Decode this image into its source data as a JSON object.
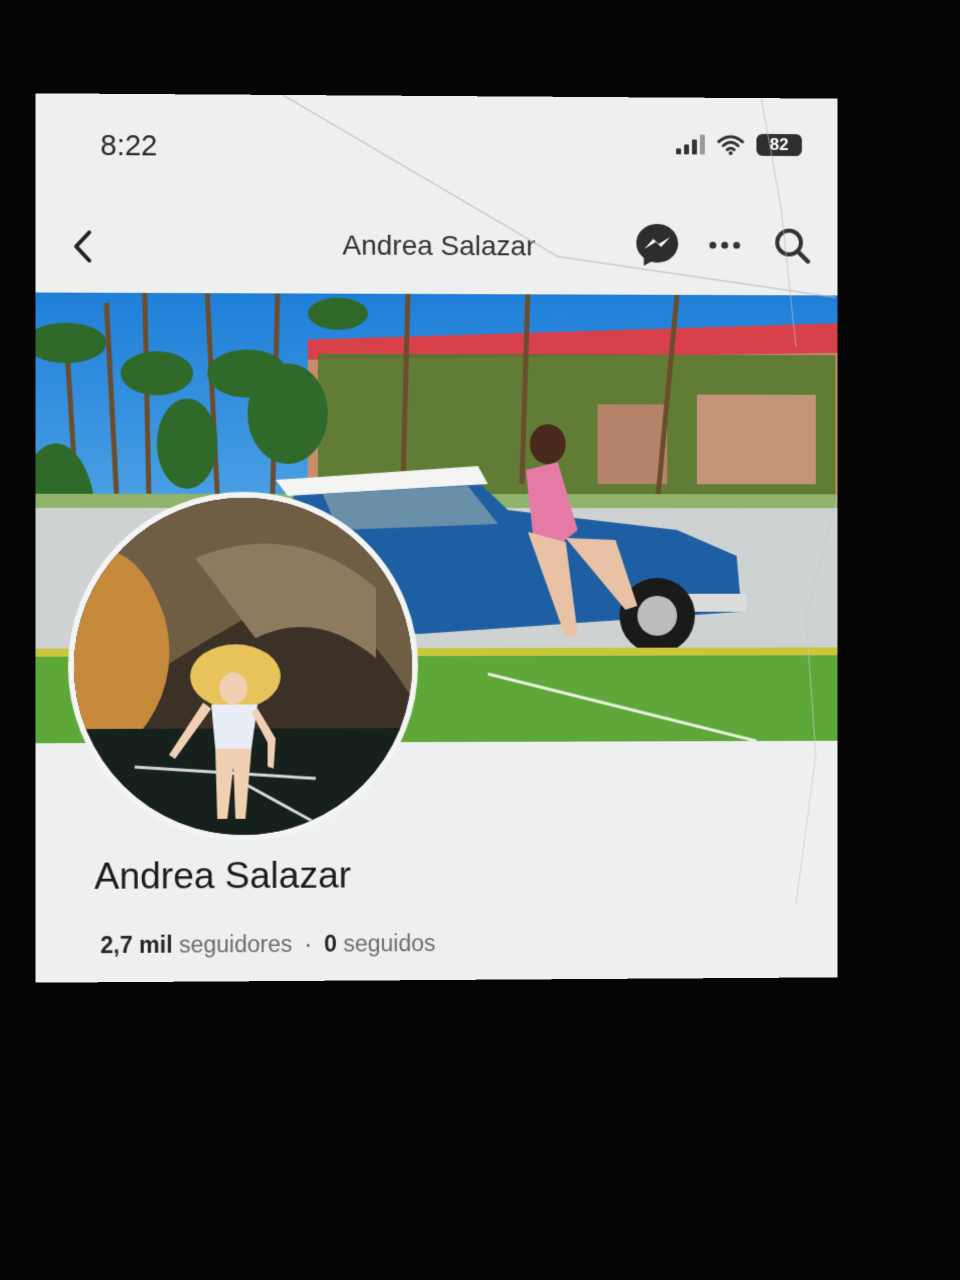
{
  "status_bar": {
    "time": "8:22",
    "battery": "82",
    "icons": [
      "signal-icon",
      "wifi-icon",
      "battery-icon"
    ]
  },
  "nav": {
    "title": "Andrea Salazar",
    "icons": [
      "back-icon",
      "messenger-icon",
      "more-icon",
      "search-icon"
    ]
  },
  "profile": {
    "name": "Andrea Salazar",
    "followers_count": "2,7 mil",
    "followers_label": "seguidores",
    "separator": "·",
    "following_count": "0",
    "following_label": "seguidos"
  },
  "colors": {
    "screen_bg": "#eef0ef",
    "text_primary": "#1c1c1c",
    "text_secondary": "#6d6d6d",
    "messenger": "#2d2d2d"
  }
}
